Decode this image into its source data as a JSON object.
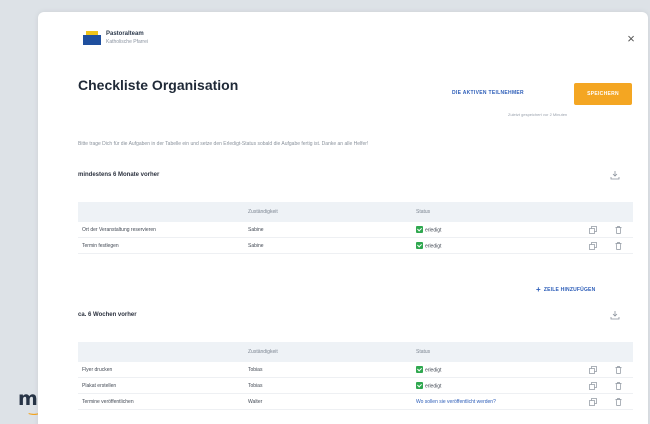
{
  "backdrop": {
    "logo_text": "m!",
    "logo_smile": "‿"
  },
  "modal": {
    "close_label": "×",
    "brand": {
      "name": "Pastoralteam",
      "subtitle": "Katholische Pfarrei"
    },
    "title": "Checkliste Organisation",
    "participants_button": "DIE AKTIVEN TEILNEHMER",
    "save_button": "SPEICHERN",
    "save_note": "Zuletzt gespeichert vor 2 Minuten",
    "intro": "Bitte trage Dich für die Aufgaben in der Tabelle ein und setze den Erledigt-Status sobald die Aufgabe fertig ist. Danke an alle Helfer!",
    "sections": [
      {
        "title": "mindestens 6 Monate vorher",
        "headers": {
          "task": "",
          "assignee": "Zuständigkeit",
          "status": "Status"
        },
        "rows": [
          {
            "task": "Ort der Veranstaltung reservieren",
            "assignee": "Sabine",
            "status": "erledigt",
            "done": true
          },
          {
            "task": "Termin festlegen",
            "assignee": "Sabine",
            "status": "erledigt",
            "done": true
          }
        ],
        "add_row": "ZEILE HINZUFÜGEN"
      },
      {
        "title": "ca. 6 Wochen vorher",
        "headers": {
          "task": "",
          "assignee": "Zuständigkeit",
          "status": "Status"
        },
        "rows": [
          {
            "task": "Flyer drucken",
            "assignee": "Tobias",
            "status": "erledigt",
            "done": true
          },
          {
            "task": "Plakat erstellen",
            "assignee": "Tobias",
            "status": "erledigt",
            "done": true
          },
          {
            "task": "Termine veröffentlichen",
            "assignee": "Walter",
            "status": "Wo sollen sie veröffentlicht werden?",
            "done": false
          }
        ]
      }
    ]
  },
  "colors": {
    "accent": "#f4a622",
    "link": "#2c5db8",
    "done": "#2fa84f"
  }
}
